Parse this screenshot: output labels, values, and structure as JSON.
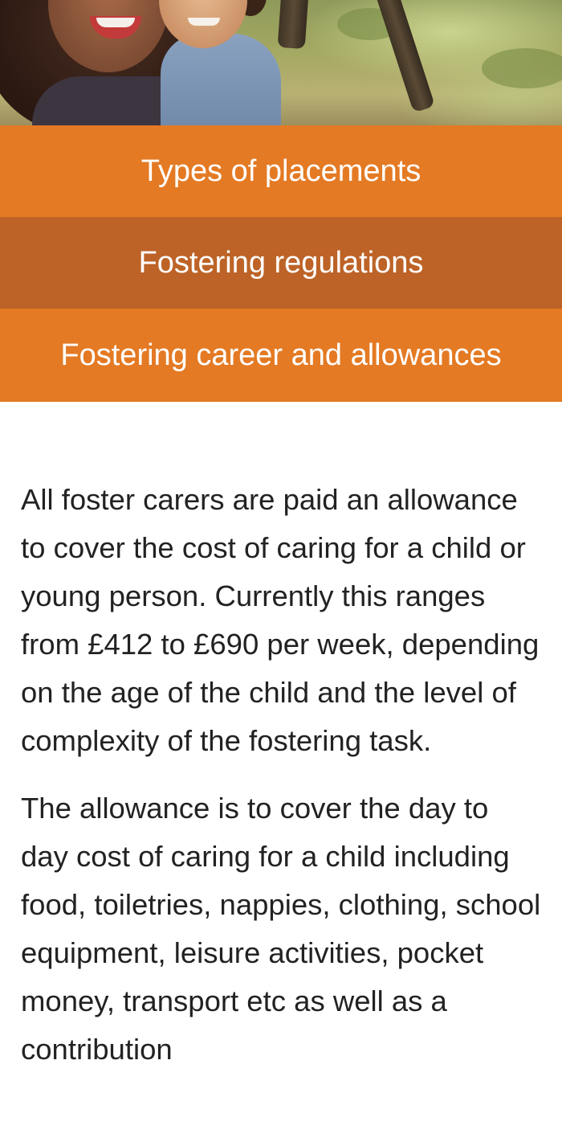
{
  "menu": {
    "items": [
      {
        "label": "Types of placements"
      },
      {
        "label": "Fostering regulations"
      },
      {
        "label": "Fostering career and allowances"
      }
    ]
  },
  "content": {
    "paragraphs": [
      "All foster carers are paid an allowance to cover the cost of caring for a child or young person. Currently this ranges from £412 to £690 per week, depending on the age of the child and the level of complexity of the fostering task.",
      "The allowance is to cover the day to day cost of caring for a child including food, toiletries, nappies, clothing, school equipment, leisure activities, pocket money, transport etc as well as a contribution"
    ]
  },
  "colors": {
    "menu_orange": "#e47a24",
    "menu_dark_orange": "#bd6327",
    "text": "#222222"
  }
}
